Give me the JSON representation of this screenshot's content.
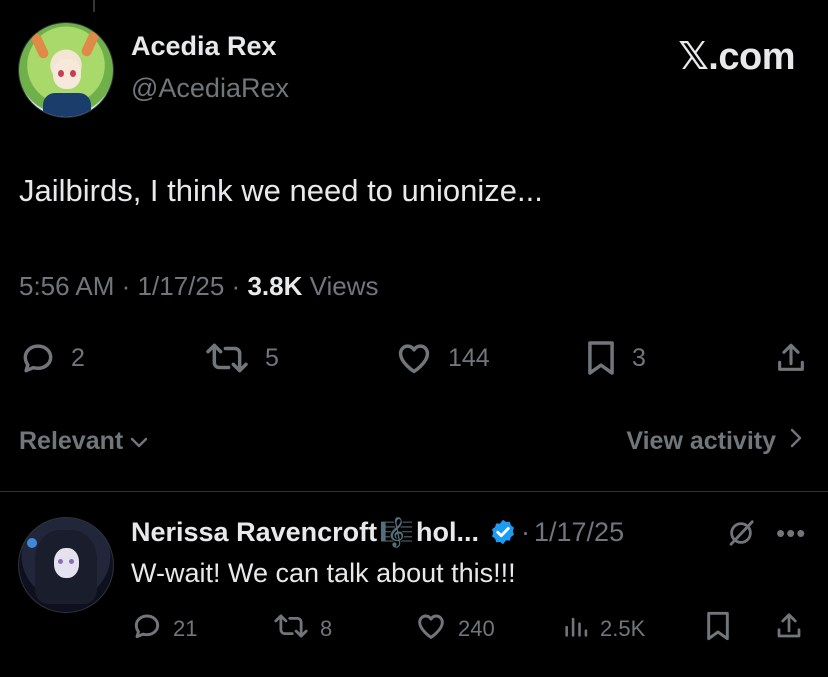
{
  "tweet": {
    "author_name": "Acedia Rex",
    "author_handle": "@AcediaRex",
    "brand": "𝕏.com",
    "text": "Jailbirds, I think we need to unionize...",
    "time": "5:56 AM",
    "date": "1/17/25",
    "separator": "·",
    "views_count": "3.8K",
    "views_label": "Views",
    "replies": "2",
    "reposts": "5",
    "likes": "144",
    "bookmarks": "3"
  },
  "sort": {
    "relevant_label": "Relevant",
    "view_activity_label": "View activity"
  },
  "reply": {
    "author_name": "Nerissa Ravencroft",
    "author_name_suffix": "hol...",
    "music_glyph": "🎼",
    "separator": "·",
    "date": "1/17/25",
    "text": "W-wait! We can talk about this!!!",
    "replies": "21",
    "reposts": "8",
    "likes": "240",
    "views": "2.5K"
  },
  "colors": {
    "background": "#000000",
    "text_primary": "#e7e9ea",
    "text_secondary": "#71767b",
    "verified_blue": "#1d9bf0",
    "divider": "#2f3336"
  },
  "icons": [
    "reply-icon",
    "repost-icon",
    "like-icon",
    "bookmark-icon",
    "share-icon",
    "chevron-down-icon",
    "chevron-right-icon",
    "verified-badge-icon",
    "grok-icon",
    "more-icon",
    "views-icon"
  ]
}
